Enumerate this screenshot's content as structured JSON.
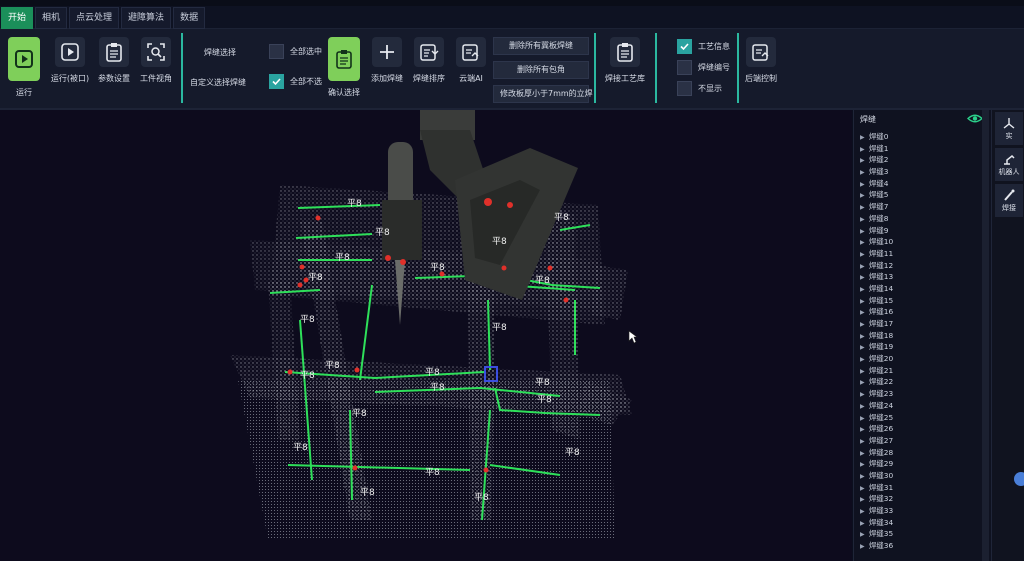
{
  "tabs": [
    "开始",
    "相机",
    "点云处理",
    "避障算法",
    "数据"
  ],
  "toolbar": {
    "run": "运行",
    "run_window": "运行(被口)",
    "params": "参数设置",
    "workpiece_view": "工件视角",
    "seam_select": "焊缝选择",
    "custom_select": "自定义选择焊缝",
    "select_all": "全部选中",
    "deselect_all": "全部不选",
    "confirm_select": "确认选择",
    "add_seam": "添加焊缝",
    "seam_sort": "焊缝排序",
    "cloud_ai": "云端AI",
    "delete_vertical": "删除所有冀板焊缝",
    "delete_wrap": "删除所有包角",
    "modify_thickness": "修改板厚小于7mm的立焊",
    "weld_process_lib": "焊接工艺库",
    "process_info": "工艺信息",
    "seam_number": "焊缝编号",
    "hide": "不显示",
    "post_control": "后端控制"
  },
  "checks": {
    "select_all": false,
    "deselect_all": true,
    "process_info": true,
    "seam_number": false,
    "hide": false
  },
  "tree": {
    "header": "焊缝",
    "items": [
      "焊缝0",
      "焊缝1",
      "焊缝2",
      "焊缝3",
      "焊缝4",
      "焊缝5",
      "焊缝7",
      "焊缝8",
      "焊缝9",
      "焊缝10",
      "焊缝11",
      "焊缝12",
      "焊缝13",
      "焊缝14",
      "焊缝15",
      "焊缝16",
      "焊缝17",
      "焊缝18",
      "焊缝19",
      "焊缝20",
      "焊缝21",
      "焊缝22",
      "焊缝23",
      "焊缝24",
      "焊缝25",
      "焊缝26",
      "焊缝27",
      "焊缝28",
      "焊缝29",
      "焊缝30",
      "焊缝31",
      "焊缝32",
      "焊缝33",
      "焊缝34",
      "焊缝35",
      "焊缝36"
    ]
  },
  "sidebar": {
    "actual": "实",
    "robot": "机器人",
    "weld": "焊接"
  },
  "viewport": {
    "seam_label": "平8",
    "seam_marker": "0",
    "labels": [
      "平8",
      "平8",
      "平8",
      "平8",
      "平8",
      "平8",
      "平8",
      "平8",
      "平8",
      "平8",
      "平8",
      "平8",
      "平8",
      "平8",
      "平8",
      "平8",
      "平8",
      "平8",
      "平8",
      "平8",
      "平8",
      "平8"
    ]
  },
  "colors": {
    "accent": "#2bb8a0",
    "run_green": "#7fcf5a",
    "seam_green": "#2ee05a",
    "marker_red": "#e0302a"
  }
}
